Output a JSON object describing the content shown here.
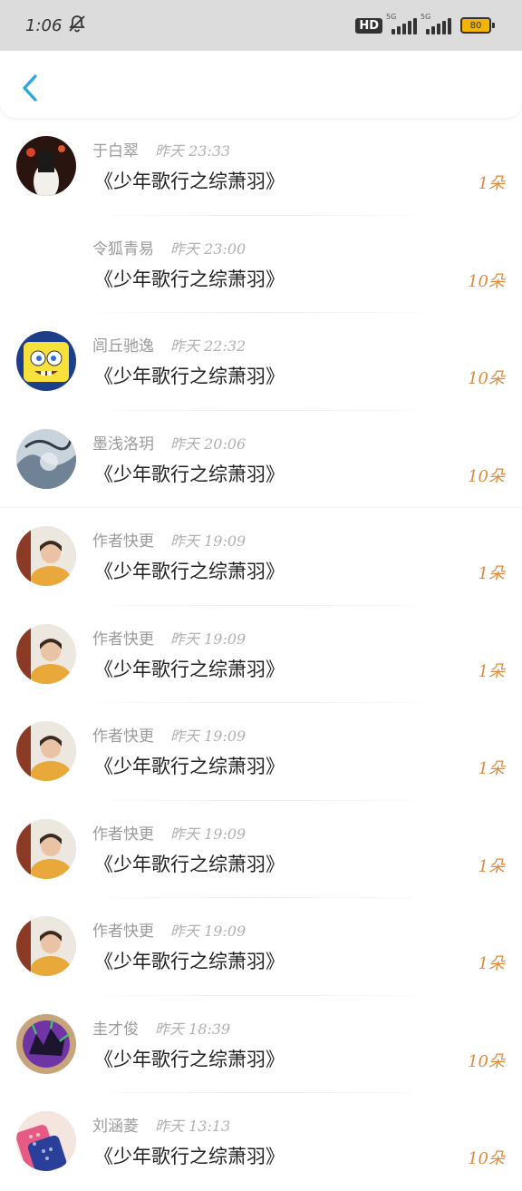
{
  "status": {
    "time": "1:06",
    "hd": "HD",
    "net1": "5G",
    "net2": "5G",
    "battery": "80"
  },
  "rows": [
    {
      "name": "于白翠",
      "time": "昨天 23:33",
      "title": "《少年歌行之综萧羽》",
      "count": "1朵",
      "avatar": "avatar-woman-red-lantern"
    },
    {
      "name": "令狐青易",
      "time": "昨天 23:00",
      "title": "《少年歌行之综萧羽》",
      "count": "10朵",
      "avatar": ""
    },
    {
      "name": "闾丘驰逸",
      "time": "昨天 22:32",
      "title": "《少年歌行之综萧羽》",
      "count": "10朵",
      "avatar": "avatar-spongebob"
    },
    {
      "name": "墨浅洛玥",
      "time": "昨天 20:06",
      "title": "《少年歌行之综萧羽》",
      "count": "10朵",
      "avatar": "avatar-ink-landscape"
    },
    {
      "name": "作者快更",
      "time": "昨天 19:09",
      "title": "《少年歌行之综萧羽》",
      "count": "1朵",
      "avatar": "avatar-boy-yellow"
    },
    {
      "name": "作者快更",
      "time": "昨天 19:09",
      "title": "《少年歌行之综萧羽》",
      "count": "1朵",
      "avatar": "avatar-boy-yellow"
    },
    {
      "name": "作者快更",
      "time": "昨天 19:09",
      "title": "《少年歌行之综萧羽》",
      "count": "1朵",
      "avatar": "avatar-boy-yellow"
    },
    {
      "name": "作者快更",
      "time": "昨天 19:09",
      "title": "《少年歌行之综萧羽》",
      "count": "1朵",
      "avatar": "avatar-boy-yellow"
    },
    {
      "name": "作者快更",
      "time": "昨天 19:09",
      "title": "《少年歌行之综萧羽》",
      "count": "1朵",
      "avatar": "avatar-boy-yellow"
    },
    {
      "name": "圭才俊",
      "time": "昨天 18:39",
      "title": "《少年歌行之综萧羽》",
      "count": "10朵",
      "avatar": "avatar-purple-monster"
    },
    {
      "name": "刘涵菱",
      "time": "昨天 13:13",
      "title": "《少年歌行之综萧羽》",
      "count": "10朵",
      "avatar": "avatar-pink-pattern"
    }
  ],
  "colors": {
    "accent": "#2aa6dc",
    "count": "#e08a3c"
  }
}
